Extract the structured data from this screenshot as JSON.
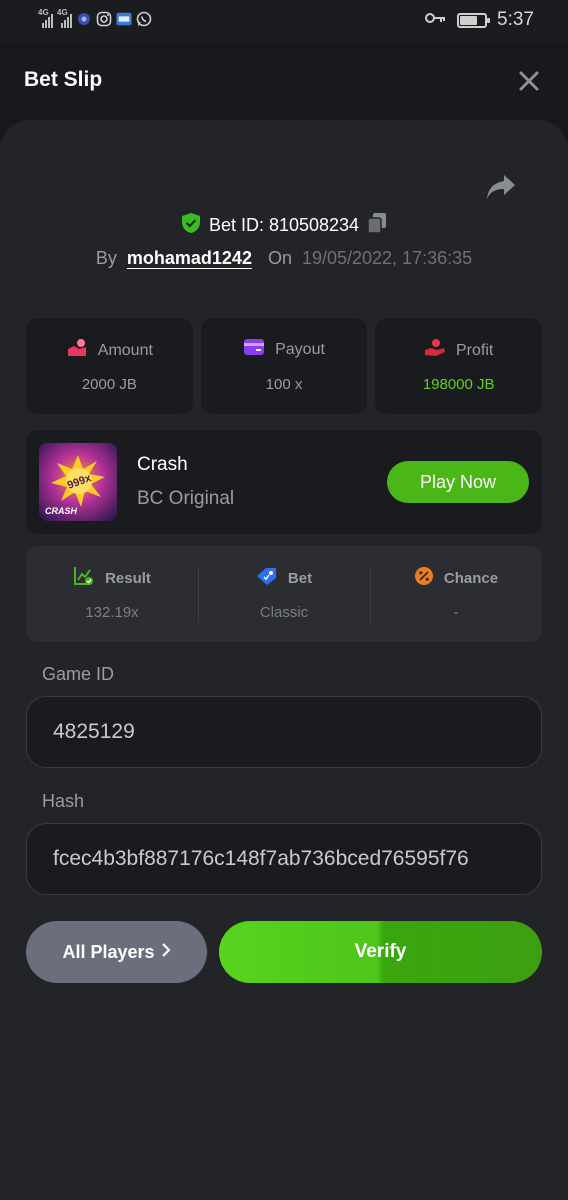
{
  "status_bar": {
    "network_1": "4G",
    "network_2": "4G",
    "time": "5:37",
    "icons": [
      "signal-icon",
      "signal-icon",
      "notification-icon",
      "instagram-icon",
      "app-icon",
      "whatsapp-icon",
      "key-icon",
      "battery-icon"
    ]
  },
  "header": {
    "title": "Bet Slip",
    "close_icon": "close-icon"
  },
  "bet": {
    "id_label": "Bet ID: 810508234",
    "by_label": "By",
    "username": "mohamad1242",
    "on_label": "On",
    "datetime": "19/05/2022, 17:36:35"
  },
  "stats": [
    {
      "label": "Amount",
      "value": "2000 JB",
      "icon": "amount-icon"
    },
    {
      "label": "Payout",
      "value": "100 x",
      "icon": "card-icon"
    },
    {
      "label": "Profit",
      "value": "198000 JB",
      "icon": "profit-icon",
      "color": "#5ed11e"
    }
  ],
  "game": {
    "name": "Crash",
    "provider": "BC Original",
    "play_label": "Play Now",
    "thumb_multiplier": "999x",
    "thumb_title": "CRASH"
  },
  "details": [
    {
      "label": "Result",
      "value": "132.19x",
      "icon": "chart-icon"
    },
    {
      "label": "Bet",
      "value": "Classic",
      "icon": "tag-icon"
    },
    {
      "label": "Chance",
      "value": "-",
      "icon": "percent-icon"
    }
  ],
  "fields": {
    "game_id_label": "Game ID",
    "game_id_value": "4825129",
    "hash_label": "Hash",
    "hash_value": "fcec4b3bf887176c148f7ab736bced76595f76"
  },
  "buttons": {
    "all_players": "All Players",
    "verify": "Verify"
  },
  "colors": {
    "accent_green": "#4ab617",
    "background": "#232428",
    "card": "#1a1b1e"
  }
}
